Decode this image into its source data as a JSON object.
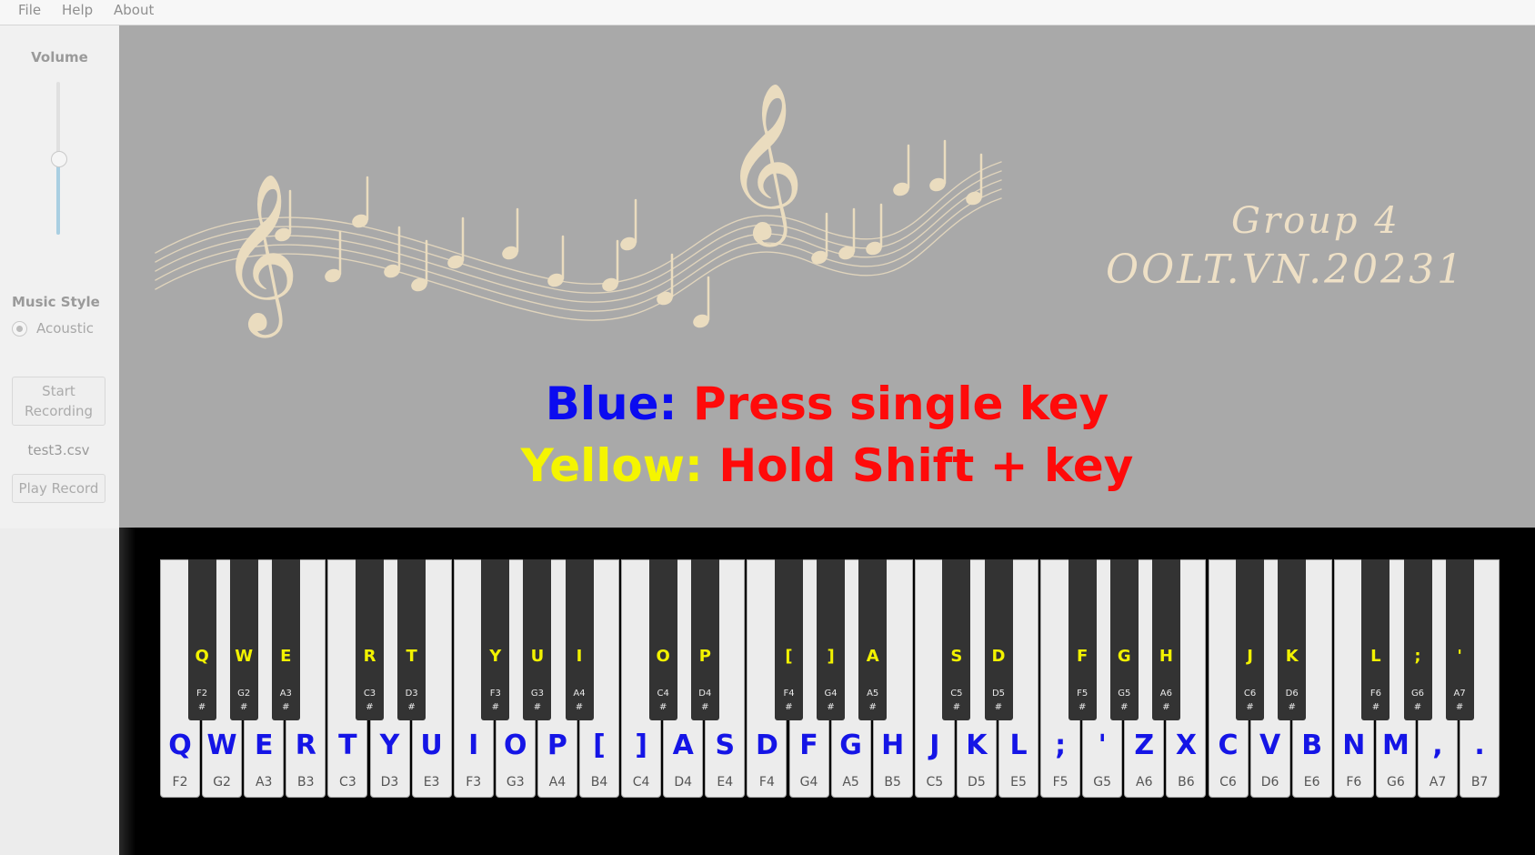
{
  "menu": [
    "File",
    "Help",
    "About"
  ],
  "sidebar": {
    "volume_label": "Volume",
    "volume_level": 0.5,
    "music_style_label": "Music Style",
    "style_option": "Acoustic",
    "start_recording": "Start Recording",
    "file_name": "test3.csv",
    "play_record": "Play Record"
  },
  "banner": {
    "group_line1": "Group 4",
    "group_line2": "OOLT.VN.20231",
    "instr1": {
      "label": "Blue:",
      "label_color": "#0b0bf0",
      "text": "Press single key",
      "text_color": "#ff0a0a"
    },
    "instr2": {
      "label": "Yellow:",
      "label_color": "#f5f500",
      "text": "Hold Shift + key",
      "text_color": "#ff0a0a"
    },
    "art_color": "#eadcbf"
  },
  "colors": {
    "white_key_label": "#1515e6",
    "black_key_label": "#f2f200"
  },
  "white_keys": [
    {
      "key": "Q",
      "note": "F2"
    },
    {
      "key": "W",
      "note": "G2"
    },
    {
      "key": "E",
      "note": "A3"
    },
    {
      "key": "R",
      "note": "B3"
    },
    {
      "key": "T",
      "note": "C3"
    },
    {
      "key": "Y",
      "note": "D3"
    },
    {
      "key": "U",
      "note": "E3"
    },
    {
      "key": "I",
      "note": "F3"
    },
    {
      "key": "O",
      "note": "G3"
    },
    {
      "key": "P",
      "note": "A4"
    },
    {
      "key": "[",
      "note": "B4"
    },
    {
      "key": "]",
      "note": "C4"
    },
    {
      "key": "A",
      "note": "D4"
    },
    {
      "key": "S",
      "note": "E4"
    },
    {
      "key": "D",
      "note": "F4"
    },
    {
      "key": "F",
      "note": "G4"
    },
    {
      "key": "G",
      "note": "A5"
    },
    {
      "key": "H",
      "note": "B5"
    },
    {
      "key": "J",
      "note": "C5"
    },
    {
      "key": "K",
      "note": "D5"
    },
    {
      "key": "L",
      "note": "E5"
    },
    {
      "key": ";",
      "note": "F5"
    },
    {
      "key": "'",
      "note": "G5"
    },
    {
      "key": "Z",
      "note": "A6"
    },
    {
      "key": "X",
      "note": "B6"
    },
    {
      "key": "C",
      "note": "C6"
    },
    {
      "key": "V",
      "note": "D6"
    },
    {
      "key": "B",
      "note": "E6"
    },
    {
      "key": "N",
      "note": "F6"
    },
    {
      "key": "M",
      "note": "G6"
    },
    {
      "key": ",",
      "note": "A7"
    },
    {
      "key": ".",
      "note": "B7"
    }
  ],
  "black_keys": [
    {
      "key": "Q",
      "note": "F2",
      "sharp": "#"
    },
    {
      "key": "W",
      "note": "G2",
      "sharp": "#"
    },
    {
      "key": "E",
      "note": "A3",
      "sharp": "#"
    },
    {
      "key": "R",
      "note": "C3",
      "sharp": "#"
    },
    {
      "key": "T",
      "note": "D3",
      "sharp": "#"
    },
    {
      "key": "Y",
      "note": "F3",
      "sharp": "#"
    },
    {
      "key": "U",
      "note": "G3",
      "sharp": "#"
    },
    {
      "key": "I",
      "note": "A4",
      "sharp": "#"
    },
    {
      "key": "O",
      "note": "C4",
      "sharp": "#"
    },
    {
      "key": "P",
      "note": "D4",
      "sharp": "#"
    },
    {
      "key": "[",
      "note": "F4",
      "sharp": "#"
    },
    {
      "key": "]",
      "note": "G4",
      "sharp": "#"
    },
    {
      "key": "A",
      "note": "A5",
      "sharp": "#"
    },
    {
      "key": "S",
      "note": "C5",
      "sharp": "#"
    },
    {
      "key": "D",
      "note": "D5",
      "sharp": "#"
    },
    {
      "key": "F",
      "note": "F5",
      "sharp": "#"
    },
    {
      "key": "G",
      "note": "G5",
      "sharp": "#"
    },
    {
      "key": "H",
      "note": "A6",
      "sharp": "#"
    },
    {
      "key": "J",
      "note": "C6",
      "sharp": "#"
    },
    {
      "key": "K",
      "note": "D6",
      "sharp": "#"
    },
    {
      "key": "L",
      "note": "F6",
      "sharp": "#"
    },
    {
      "key": ";",
      "note": "G6",
      "sharp": "#"
    },
    {
      "key": "'",
      "note": "A7",
      "sharp": "#"
    }
  ]
}
